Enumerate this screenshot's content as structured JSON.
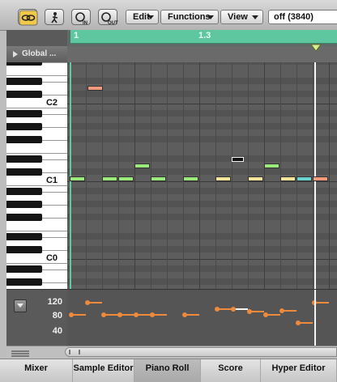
{
  "toolbar": {
    "icons": [
      "link-icon",
      "walking-man-icon",
      "midi-in-icon",
      "midi-out-icon"
    ],
    "menus": [
      {
        "label": "Edit"
      },
      {
        "label": "Functions"
      },
      {
        "label": "View"
      }
    ],
    "status": "off (3840)"
  },
  "header": {
    "global_label": "Global ...",
    "ruler_bar_1": "1",
    "ruler_bar_2": "1.3"
  },
  "keyboard": {
    "labels": [
      "C2",
      "C1",
      "C0"
    ]
  },
  "notes": {
    "colors": {
      "green": "#9be87c",
      "yellow": "#f4e59a",
      "salmon": "#f29a7e",
      "cyan": "#6ad3cf",
      "selected": "#000000"
    }
  },
  "velocity": {
    "labels": [
      "120",
      "80",
      "40"
    ],
    "values": [
      80,
      112,
      80,
      80,
      80,
      80,
      80,
      96,
      96,
      88,
      80,
      92,
      60,
      112
    ]
  },
  "tabs": [
    {
      "label": "Mixer",
      "active": false
    },
    {
      "label": "Sample Editor",
      "active": false
    },
    {
      "label": "Piano Roll",
      "active": true
    },
    {
      "label": "Score",
      "active": false
    },
    {
      "label": "Hyper Editor",
      "active": false
    }
  ]
}
